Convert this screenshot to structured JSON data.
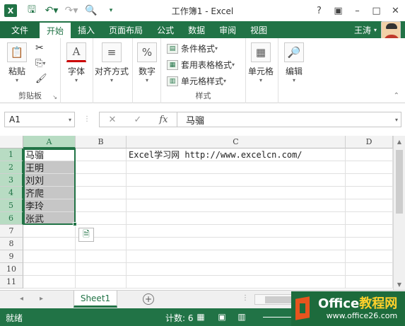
{
  "window": {
    "title": "工作簿1 - Excel",
    "app_icon_label": "X",
    "controls": [
      "?",
      "▣",
      "–",
      "□",
      "✕"
    ]
  },
  "qat": {
    "save_icon": "save-icon",
    "undo_icon": "undo-icon",
    "redo_icon": "redo-icon",
    "preview_icon": "print-preview-icon"
  },
  "tabs": [
    {
      "label": "文件"
    },
    {
      "label": "开始"
    },
    {
      "label": "插入"
    },
    {
      "label": "页面布局"
    },
    {
      "label": "公式"
    },
    {
      "label": "数据"
    },
    {
      "label": "审阅"
    },
    {
      "label": "视图"
    }
  ],
  "user": {
    "name": "王涛"
  },
  "ribbon": {
    "clipboard": {
      "paste_label": "粘贴",
      "group_label": "剪贴板"
    },
    "font": {
      "label": "字体"
    },
    "alignment": {
      "label": "对齐方式"
    },
    "number": {
      "label": "数字"
    },
    "styles": {
      "conditional": "条件格式",
      "table": "套用表格格式",
      "cell_style": "单元格样式",
      "group_label": "样式"
    },
    "cells": {
      "label": "单元格"
    },
    "editing": {
      "label": "编辑"
    }
  },
  "formula_bar": {
    "name_box": "A1",
    "cancel": "✕",
    "confirm": "✓",
    "fx": "fx",
    "content": "马骝"
  },
  "grid": {
    "columns": [
      "A",
      "B",
      "C",
      "D"
    ],
    "rows": [
      "1",
      "2",
      "3",
      "4",
      "5",
      "6",
      "7",
      "8",
      "9",
      "10",
      "11"
    ],
    "col_a": [
      "马骝",
      "王明",
      "刘刘",
      "齐爬",
      "李玲",
      "张武"
    ],
    "c1": "Excel学习网 http://www.excelcn.com/"
  },
  "sheets": {
    "active": "Sheet1",
    "add": "+"
  },
  "status": {
    "ready": "就绪",
    "count": "计数: 6"
  },
  "watermark": {
    "title_a": "Office",
    "title_b": "教程网",
    "url": "www.office26.com"
  },
  "colors": {
    "accent": "#217346",
    "selection": "#c6c6c6"
  }
}
